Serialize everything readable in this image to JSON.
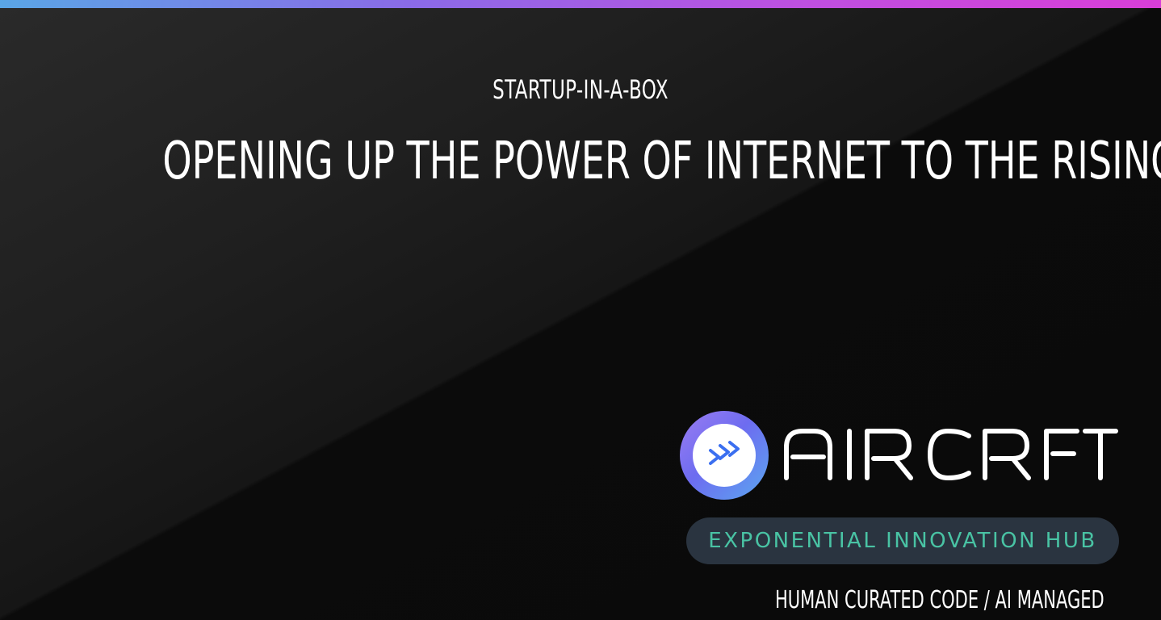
{
  "hero": {
    "kicker": "STARTUP-IN-A-BOX",
    "headline": "OPENING UP THE POWER OF INTERNET TO THE RISING BILLION"
  },
  "brand": {
    "name": "AIRCRFT",
    "logo_icon": "triple-chevron-right-icon",
    "badge": "EXPONENTIAL INNOVATION HUB",
    "tagline": "HUMAN CURATED CODE / AI MANAGED"
  },
  "colors": {
    "top_bar_start": "#5aa6e6",
    "top_bar_end": "#d93ed8",
    "badge_text": "#49c3a4",
    "badge_background": "#2a3440",
    "logo_chevrons": "#3b6ff0"
  }
}
